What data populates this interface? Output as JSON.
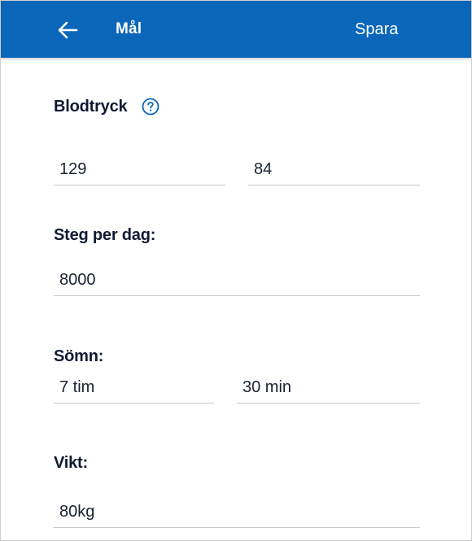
{
  "header": {
    "title": "Mål",
    "save_label": "Spara",
    "back_icon": "arrow-left-icon",
    "background_color": "#0a66b8"
  },
  "blood_pressure": {
    "label": "Blodtryck",
    "help_icon": "help-circle-icon",
    "systolic": "129",
    "diastolic": "84"
  },
  "steps": {
    "label": "Steg per dag:",
    "value": "8000"
  },
  "sleep": {
    "label": "Sömn:",
    "hours": "7 tim",
    "minutes": "30 min"
  },
  "weight": {
    "label": "Vikt:",
    "value": "80kg"
  }
}
